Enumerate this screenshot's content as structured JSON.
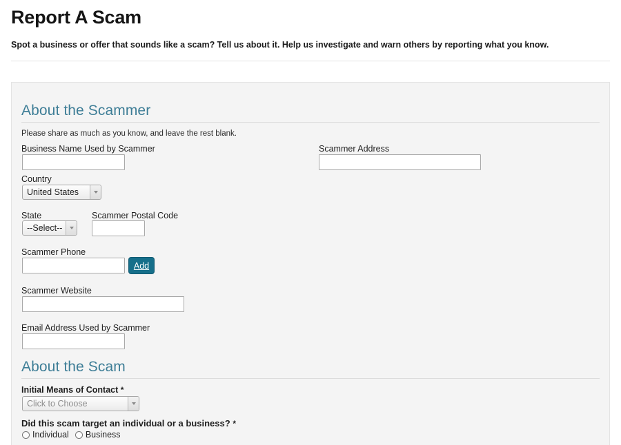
{
  "page": {
    "title": "Report A Scam",
    "intro": "Spot a business or offer that sounds like a scam? Tell us about it. Help us investigate and warn others by reporting what you know."
  },
  "colors": {
    "heading_teal": "#3d7d96",
    "button_teal": "#166f8a",
    "panel_bg": "#f4f4f4",
    "page_bg": "#ffffff"
  },
  "sections": {
    "scammer": {
      "heading": "About the Scammer",
      "hint": "Please share as much as you know, and leave the rest blank.",
      "fields": {
        "business_name": {
          "label": "Business Name Used by Scammer",
          "value": "",
          "placeholder": ""
        },
        "scammer_address": {
          "label": "Scammer Address",
          "value": "",
          "placeholder": ""
        },
        "country": {
          "label": "Country",
          "value": "United States",
          "options": [
            "United States"
          ]
        },
        "state": {
          "label": "State",
          "value": "--Select--",
          "options": [
            "--Select--"
          ]
        },
        "postal_code": {
          "label": "Scammer Postal Code",
          "value": "",
          "placeholder": ""
        },
        "phone": {
          "label": "Scammer Phone",
          "value": "",
          "placeholder": ""
        },
        "add_button": {
          "label": "Add"
        },
        "website": {
          "label": "Scammer Website",
          "value": "",
          "placeholder": ""
        },
        "email": {
          "label": "Email Address Used by Scammer",
          "value": "",
          "placeholder": ""
        }
      }
    },
    "scam": {
      "heading": "About the Scam",
      "fields": {
        "initial_contact": {
          "label": "Initial Means of Contact",
          "required_marker": "*",
          "value": "Click to Choose",
          "is_placeholder": true
        },
        "target_question": {
          "label": "Did this scam target an individual or a business?",
          "required_marker": "*",
          "options": [
            "Individual",
            "Business"
          ],
          "selected": ""
        }
      }
    }
  }
}
